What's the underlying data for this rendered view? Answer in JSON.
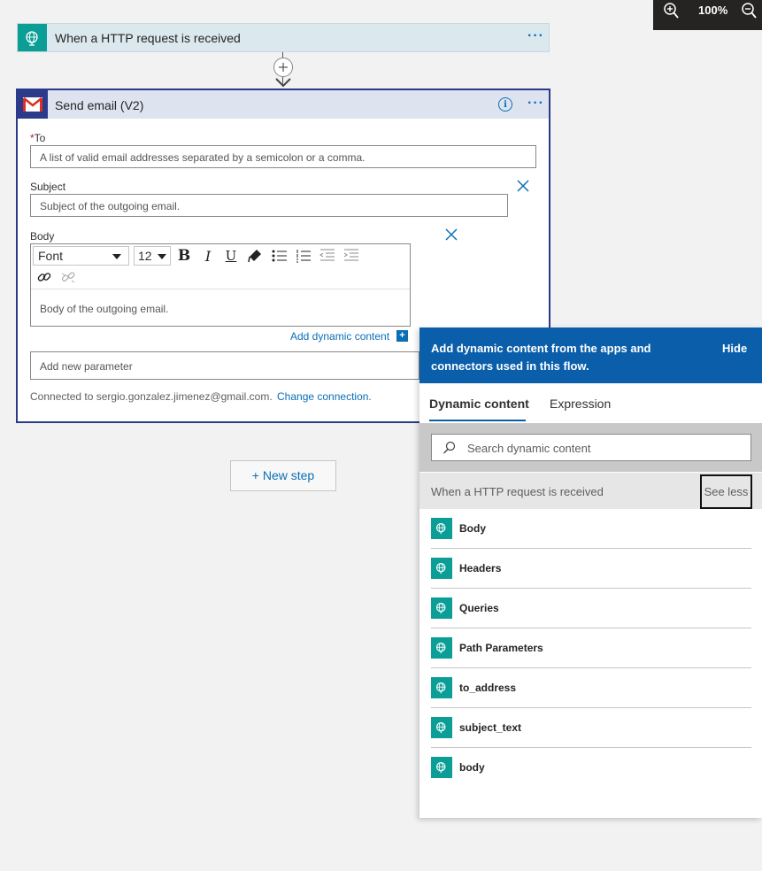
{
  "zoom": {
    "value": "100%",
    "zoom_in_icon": "zoom-in-icon",
    "zoom_out_icon": "zoom-out-icon"
  },
  "trigger": {
    "title": "When a HTTP request is received",
    "icon": "globe-request-icon",
    "menu": "···"
  },
  "action": {
    "title": "Send email (V2)",
    "icon": "gmail-icon",
    "info": "i",
    "menu": "···",
    "to": {
      "label": "To",
      "required_mark": "*",
      "placeholder": "A list of valid email addresses separated by a semicolon or a comma."
    },
    "subject": {
      "label": "Subject",
      "placeholder": "Subject of the outgoing email."
    },
    "body": {
      "label": "Body",
      "font": "Font",
      "size": "12",
      "bold": "B",
      "italic": "I",
      "underline": "U",
      "placeholder": "Body of the outgoing email."
    },
    "add_dynamic": "Add dynamic content",
    "add_dynamic_badge": "+",
    "new_param_placeholder": "Add new parameter",
    "connected": "Connected to sergio.gonzalez.jimenez@gmail.com.",
    "change_connection": "Change connection."
  },
  "new_step": "+ New step",
  "panel": {
    "title": "Add dynamic content from the apps and connectors used in this flow.",
    "hide": "Hide",
    "tabs": [
      "Dynamic content",
      "Expression"
    ],
    "search_placeholder": "Search dynamic content",
    "group_title": "When a HTTP request is received",
    "see_less": "See less",
    "items": [
      "Body",
      "Headers",
      "Queries",
      "Path Parameters",
      "to_address",
      "subject_text",
      "body"
    ]
  },
  "colors": {
    "accent": "#0a5eaa",
    "trigger_teal": "#0a9e96",
    "card_border": "#2b3a8a"
  }
}
